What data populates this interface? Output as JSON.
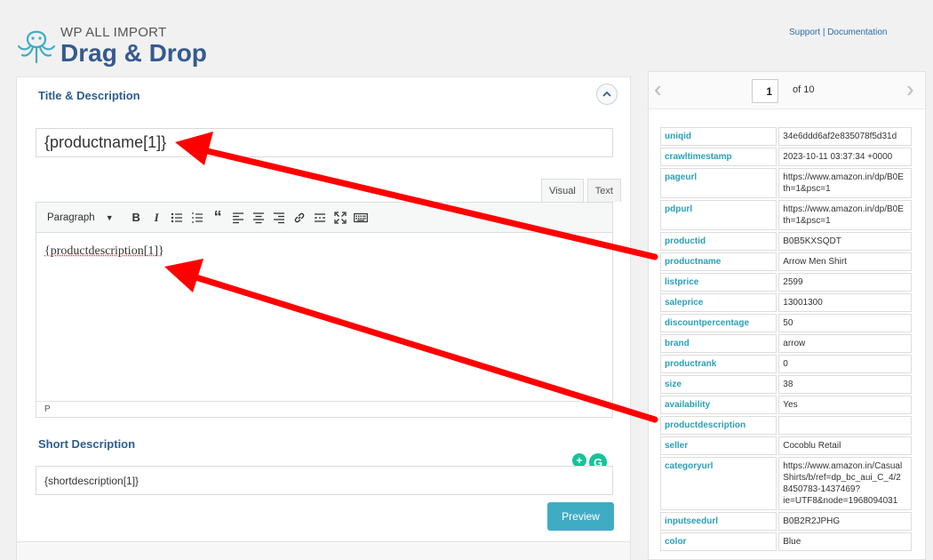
{
  "header": {
    "brand_sub": "WP ALL IMPORT",
    "brand_main": "Drag & Drop",
    "support_link": "Support",
    "separator": "|",
    "documentation_link": "Documentation"
  },
  "title_section": {
    "heading": "Title & Description",
    "title_value": "{productname[1]}"
  },
  "editor": {
    "tab_visual": "Visual",
    "tab_text": "Text",
    "format_select": "Paragraph",
    "content": "{productdescription[1]}",
    "status_path": "P"
  },
  "short_description": {
    "heading": "Short Description",
    "value": "{shortdescription[1]}",
    "preview_button": "Preview"
  },
  "pager": {
    "current": "1",
    "of_label": "of 10"
  },
  "record": [
    {
      "key": "uniqid",
      "value": "34e6ddd6af2e835078f5d31d"
    },
    {
      "key": "crawltimestamp",
      "value": "2023-10-11 03:37:34 +0000"
    },
    {
      "key": "pageurl",
      "value": "https://www.amazon.in/dp/B0E\nth=1&psc=1"
    },
    {
      "key": "pdpurl",
      "value": "https://www.amazon.in/dp/B0E\nth=1&psc=1"
    },
    {
      "key": "productid",
      "value": "B0B5KXSQDT"
    },
    {
      "key": "productname",
      "value": "Arrow Men Shirt"
    },
    {
      "key": "listprice",
      "value": "2599"
    },
    {
      "key": "saleprice",
      "value": "13001300"
    },
    {
      "key": "discountpercentage",
      "value": "50"
    },
    {
      "key": "brand",
      "value": "arrow"
    },
    {
      "key": "productrank",
      "value": "0"
    },
    {
      "key": "size",
      "value": "38"
    },
    {
      "key": "availability",
      "value": "Yes"
    },
    {
      "key": "productdescription",
      "value": ""
    },
    {
      "key": "seller",
      "value": "Cocoblu Retail"
    },
    {
      "key": "categoryurl",
      "value": "https://www.amazon.in/Casual\nShirts/b/ref=dp_bc_aui_C_4/2\n8450783-1437469?\nie=UTF8&node=1968094031"
    },
    {
      "key": "inputseedurl",
      "value": "B0B2R2JPHG"
    },
    {
      "key": "color",
      "value": "Blue"
    }
  ],
  "colors": {
    "brand": "#345a8f",
    "accent": "#40acc4",
    "arrow": "#ff0000",
    "key_text": "#2aa0b8"
  }
}
